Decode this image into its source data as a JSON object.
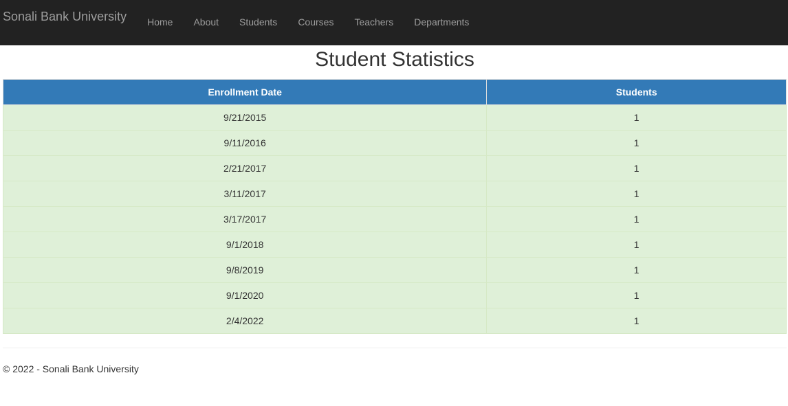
{
  "navbar": {
    "brand": "Sonali Bank University",
    "items": [
      {
        "label": "Home"
      },
      {
        "label": "About"
      },
      {
        "label": "Students"
      },
      {
        "label": "Courses"
      },
      {
        "label": "Teachers"
      },
      {
        "label": "Departments"
      }
    ]
  },
  "page": {
    "title": "Student Statistics"
  },
  "table": {
    "columns": [
      "Enrollment Date",
      "Students"
    ],
    "rows": [
      {
        "date": "9/21/2015",
        "students": "1"
      },
      {
        "date": "9/11/2016",
        "students": "1"
      },
      {
        "date": "2/21/2017",
        "students": "1"
      },
      {
        "date": "3/11/2017",
        "students": "1"
      },
      {
        "date": "3/17/2017",
        "students": "1"
      },
      {
        "date": "9/1/2018",
        "students": "1"
      },
      {
        "date": "9/8/2019",
        "students": "1"
      },
      {
        "date": "9/1/2020",
        "students": "1"
      },
      {
        "date": "2/4/2022",
        "students": "1"
      }
    ]
  },
  "footer": {
    "text": "© 2022 - Sonali Bank University"
  },
  "colors": {
    "navbar_bg": "#222222",
    "nav_text": "#9d9d9d",
    "header_bg": "#337ab7",
    "row_bg": "#dff0d8"
  }
}
